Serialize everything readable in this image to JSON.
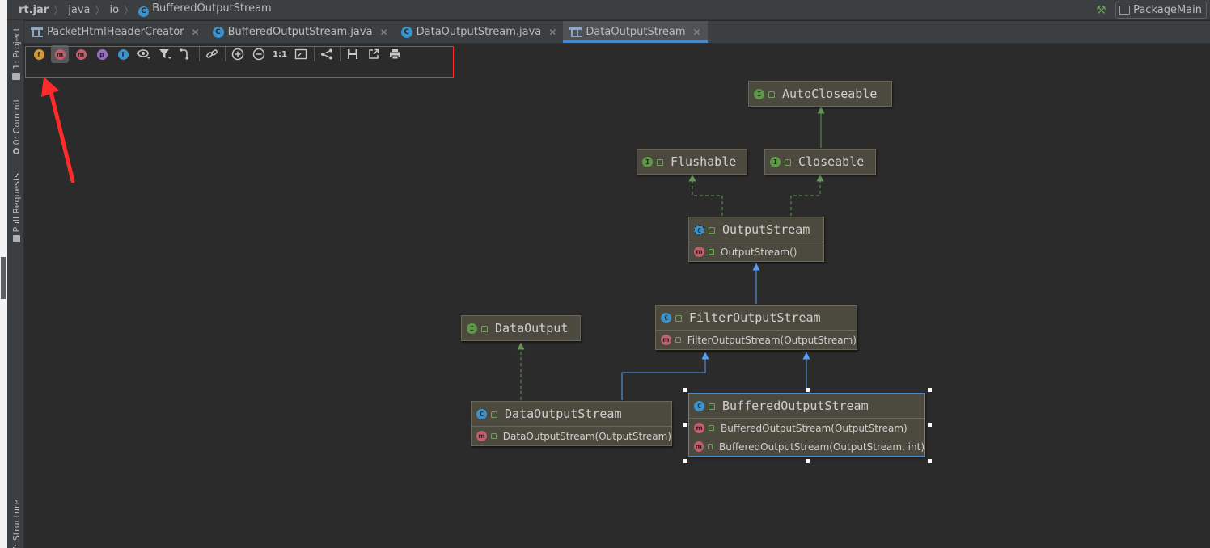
{
  "navbar": {
    "breadcrumbs": [
      "rt.jar",
      "java",
      "io",
      "BufferedOutputStream"
    ],
    "run_config": "PackageMain"
  },
  "left_stripe": {
    "project": "1: Project",
    "commit": "0: Commit",
    "pull_requests": "Pull Requests",
    "structure": "Z: Structure"
  },
  "tabs": [
    {
      "label": "PacketHtmlHeaderCreator",
      "icon": "diagram-icon",
      "active": false
    },
    {
      "label": "BufferedOutputStream.java",
      "icon": "class-icon",
      "active": false
    },
    {
      "label": "DataOutputStream.java",
      "icon": "class-icon",
      "active": false
    },
    {
      "label": "DataOutputStream",
      "icon": "diagram-icon",
      "active": true
    }
  ],
  "toolbar": {
    "fields": "f",
    "constructors": "m",
    "methods": "m",
    "properties": "p",
    "inner": "I",
    "actual_size": "1:1"
  },
  "diagram": {
    "nodes": [
      {
        "id": "autocloseable",
        "kind": "I",
        "name": "AutoCloseable",
        "members": []
      },
      {
        "id": "flushable",
        "kind": "I",
        "name": "Flushable",
        "members": []
      },
      {
        "id": "closeable",
        "kind": "I",
        "name": "Closeable",
        "members": []
      },
      {
        "id": "outputstream",
        "kind": "C",
        "name": "OutputStream",
        "members": [
          "OutputStream()"
        ]
      },
      {
        "id": "filteroutputstream",
        "kind": "C",
        "name": "FilterOutputStream",
        "members": [
          "FilterOutputStream(OutputStream)"
        ]
      },
      {
        "id": "dataoutput",
        "kind": "I",
        "name": "DataOutput",
        "members": []
      },
      {
        "id": "dataoutputstream",
        "kind": "C",
        "name": "DataOutputStream",
        "members": [
          "DataOutputStream(OutputStream)"
        ]
      },
      {
        "id": "bufferedoutputstream",
        "kind": "C",
        "name": "BufferedOutputStream",
        "members": [
          "BufferedOutputStream(OutputStream)",
          "BufferedOutputStream(OutputStream, int)"
        ]
      }
    ]
  },
  "colors": {
    "background": "#2b2b2b",
    "extends_edge": "#589df6",
    "implements_edge": "#629755",
    "annotation": "#ff2a2a",
    "node_fill": "#4c4a3f"
  }
}
